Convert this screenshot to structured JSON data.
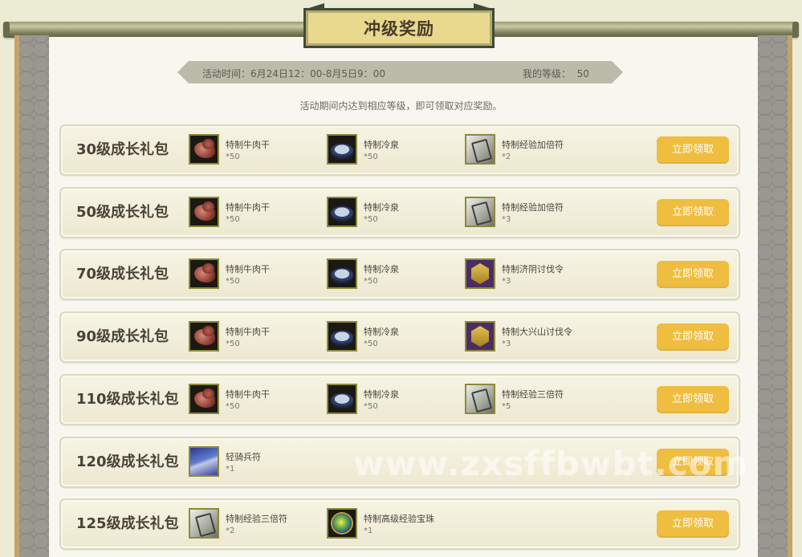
{
  "title": "冲级奖励",
  "info": {
    "activity_time": "活动时间：6月24日12：00-8月5日9：00",
    "my_level_label": "我的等级：",
    "my_level_value": "50"
  },
  "hint": "活动期间内达到相应等级，即可领取对应奖励。",
  "claim_label": "立即领取",
  "watermark": "www.zxsffbwbt.com",
  "rows": [
    {
      "title": "30级成长礼包",
      "items": [
        {
          "name": "特制牛肉干",
          "qty": "*50",
          "icon": "beef-jerky-icon"
        },
        {
          "name": "特制冷泉",
          "qty": "*50",
          "icon": "cold-spring-bowl-icon"
        },
        {
          "name": "特制经验加倍符",
          "qty": "*2",
          "icon": "exp-double-talisman-icon"
        }
      ]
    },
    {
      "title": "50级成长礼包",
      "items": [
        {
          "name": "特制牛肉干",
          "qty": "*50",
          "icon": "beef-jerky-icon"
        },
        {
          "name": "特制冷泉",
          "qty": "*50",
          "icon": "cold-spring-bowl-icon"
        },
        {
          "name": "特制经验加倍符",
          "qty": "*3",
          "icon": "exp-double-talisman-icon"
        }
      ]
    },
    {
      "title": "70级成长礼包",
      "items": [
        {
          "name": "特制牛肉干",
          "qty": "*50",
          "icon": "beef-jerky-icon"
        },
        {
          "name": "特制冷泉",
          "qty": "*50",
          "icon": "cold-spring-bowl-icon"
        },
        {
          "name": "特制济阴讨伐令",
          "qty": "*3",
          "icon": "campaign-token-icon"
        }
      ]
    },
    {
      "title": "90级成长礼包",
      "items": [
        {
          "name": "特制牛肉干",
          "qty": "*50",
          "icon": "beef-jerky-icon"
        },
        {
          "name": "特制冷泉",
          "qty": "*50",
          "icon": "cold-spring-bowl-icon"
        },
        {
          "name": "特制大兴山讨伐令",
          "qty": "*3",
          "icon": "campaign-token-icon"
        }
      ]
    },
    {
      "title": "110级成长礼包",
      "items": [
        {
          "name": "特制牛肉干",
          "qty": "*50",
          "icon": "beef-jerky-icon"
        },
        {
          "name": "特制冷泉",
          "qty": "*50",
          "icon": "cold-spring-bowl-icon"
        },
        {
          "name": "特制经验三倍符",
          "qty": "*5",
          "icon": "exp-triple-talisman-icon"
        }
      ]
    },
    {
      "title": "120级成长礼包",
      "items": [
        {
          "name": "轻骑兵符",
          "qty": "*1",
          "icon": "light-cavalry-talisman-icon"
        }
      ]
    },
    {
      "title": "125级成长礼包",
      "items": [
        {
          "name": "特制经验三倍符",
          "qty": "*2",
          "icon": "exp-triple-talisman-icon"
        },
        {
          "name": "特制高级经验宝珠",
          "qty": "*1",
          "icon": "exp-orb-icon"
        }
      ]
    }
  ]
}
